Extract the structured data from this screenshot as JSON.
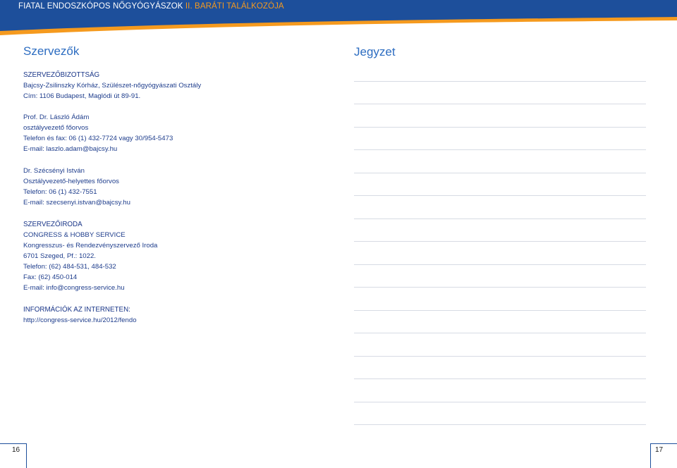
{
  "header": {
    "title_main": "FIATAL ENDOSZKÓPOS NŐGYÓGYÁSZOK",
    "title_accent": "II. BARÁTI TALÁLKOZÓJA",
    "bg_color": "#1d4f9b",
    "accent_color": "#f59a1e"
  },
  "left": {
    "title": "Szervezők",
    "committee": {
      "heading": "SZERVEZŐBIZOTTSÁG",
      "line1": "Bajcsy-Zsilinszky Kórház, Szülészet-nőgyógyászati Osztály",
      "line2": "Cím: 1106 Budapest, Maglódi út 89-91."
    },
    "person1": {
      "name": "Prof. Dr. László Ádám",
      "role": "osztályvezető főorvos",
      "phone": "Telefon és fax: 06 (1) 432-7724 vagy 30/954-5473",
      "email": "E-mail: laszlo.adam@bajcsy.hu"
    },
    "person2": {
      "name": "Dr. Szécsényi István",
      "role": "Osztályvezető-helyettes főorvos",
      "phone": "Telefon: 06 (1) 432-7551",
      "email": "E-mail: szecsenyi.istvan@bajcsy.hu"
    },
    "office": {
      "heading": "SZERVEZŐIRODA",
      "company": "CONGRESS & HOBBY SERVICE",
      "desc": "Kongresszus- és Rendezvényszervező Iroda",
      "address": "6701 Szeged, Pf.: 1022.",
      "phone": "Telefon: (62) 484-531, 484-532",
      "fax": "Fax: (62) 450-014",
      "email": "E-mail: info@congress-service.hu"
    },
    "info": {
      "heading": "INFORMÁCIÓK AZ INTERNETEN:",
      "url": "http://congress-service.hu/2012/fendo"
    }
  },
  "right": {
    "title": "Jegyzet"
  },
  "footer": {
    "page_left": "16",
    "page_right": "17"
  }
}
